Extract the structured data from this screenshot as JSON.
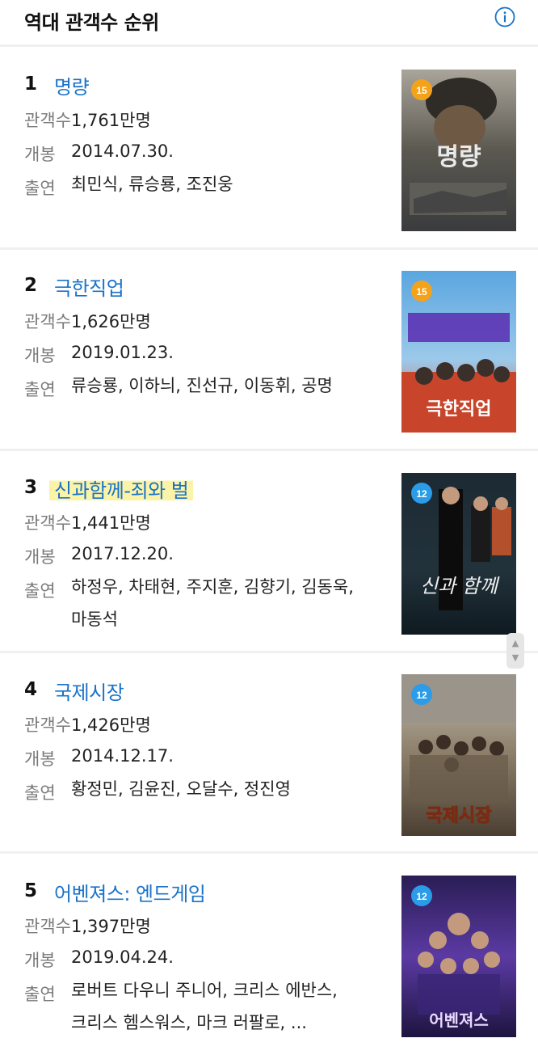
{
  "header": {
    "title": "역대 관객수 순위",
    "info_icon": "info-circle-icon"
  },
  "labels": {
    "audience": "관객수",
    "release": "개봉",
    "cast": "출연"
  },
  "colors": {
    "link": "#1a73c9",
    "highlight": "#fbf3a8",
    "badge15": "#f5a21b",
    "badge12": "#2b9ce8"
  },
  "movies": [
    {
      "rank": "1",
      "title": "명량",
      "audience": "1,761만명",
      "release": "2014.07.30.",
      "cast": "최민식, 류승룡, 조진웅",
      "rating": "15",
      "poster_text": "명량"
    },
    {
      "rank": "2",
      "title": "극한직업",
      "audience": "1,626만명",
      "release": "2019.01.23.",
      "cast": "류승룡, 이하늬, 진선규, 이동휘, 공명",
      "rating": "15",
      "poster_text": "극한직업"
    },
    {
      "rank": "3",
      "title": "신과함께-죄와 벌",
      "audience": "1,441만명",
      "release": "2017.12.20.",
      "cast": "하정우, 차태현, 주지훈, 김향기, 김동욱, 마동석",
      "rating": "12",
      "poster_text": "신과 함께"
    },
    {
      "rank": "4",
      "title": "국제시장",
      "audience": "1,426만명",
      "release": "2014.12.17.",
      "cast": "황정민, 김윤진, 오달수, 정진영",
      "rating": "12",
      "poster_text": "국제시장"
    },
    {
      "rank": "5",
      "title": "어벤져스: 엔드게임",
      "audience": "1,397만명",
      "release": "2019.04.24.",
      "cast": "로버트 다우니 주니어, 크리스 에반스, 크리스 헴스워스, 마크 러팔로, ...",
      "rating": "12",
      "poster_text": "어벤져스"
    }
  ]
}
